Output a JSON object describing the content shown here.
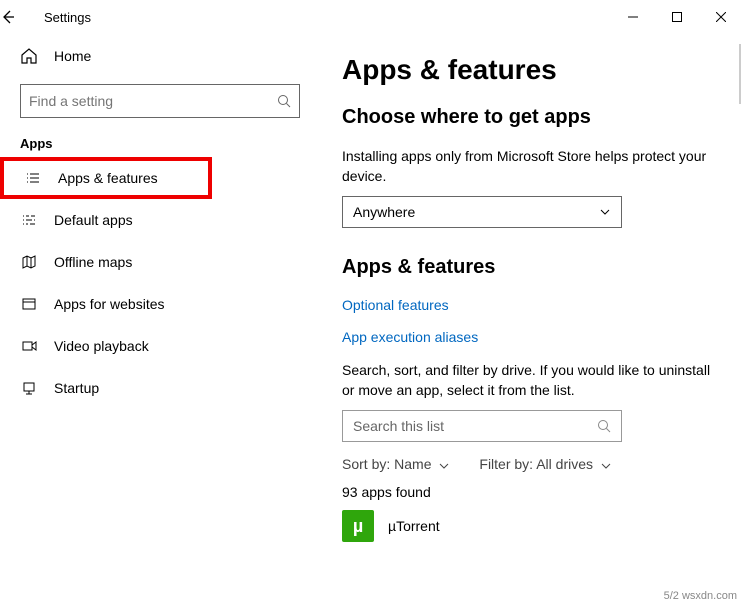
{
  "titlebar": {
    "title": "Settings"
  },
  "sidebar": {
    "home": "Home",
    "search_placeholder": "Find a setting",
    "group": "Apps",
    "items": [
      {
        "label": "Apps & features"
      },
      {
        "label": "Default apps"
      },
      {
        "label": "Offline maps"
      },
      {
        "label": "Apps for websites"
      },
      {
        "label": "Video playback"
      },
      {
        "label": "Startup"
      }
    ]
  },
  "main": {
    "h1": "Apps & features",
    "h2a": "Choose where to get apps",
    "desc": "Installing apps only from Microsoft Store helps protect your device.",
    "select_value": "Anywhere",
    "h2b": "Apps & features",
    "link1": "Optional features",
    "link2": "App execution aliases",
    "listdesc": "Search, sort, and filter by drive. If you would like to uninstall or move an app, select it from the list.",
    "search_list_placeholder": "Search this list",
    "sort_label": "Sort by:",
    "sort_value": "Name",
    "filter_label": "Filter by:",
    "filter_value": "All drives",
    "count": "93 apps found",
    "app0": {
      "name": "µTorrent",
      "glyph": "µ"
    }
  },
  "footer": {
    "watermark": "wsxdn.com",
    "date_fragment": "5/2"
  }
}
